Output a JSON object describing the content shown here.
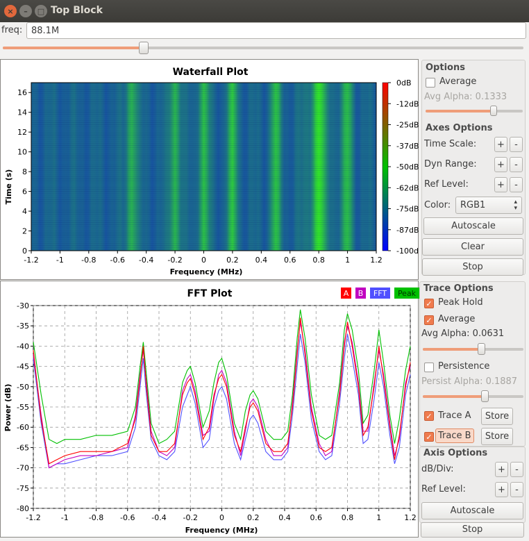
{
  "window": {
    "title": "Top Block"
  },
  "freq": {
    "label": "freq:",
    "value": "88.1M",
    "slider_fraction": 0.27
  },
  "waterfall": {
    "title": "Waterfall Plot",
    "xlabel": "Frequency (MHz)",
    "ylabel": "Time (s)",
    "x_ticks": [
      "-1.2",
      "-1",
      "-0.8",
      "-0.6",
      "-0.4",
      "-0.2",
      "0",
      "0.2",
      "0.4",
      "0.6",
      "0.8",
      "1",
      "1.2"
    ],
    "y_ticks": [
      "0",
      "2",
      "4",
      "6",
      "8",
      "10",
      "12",
      "14",
      "16"
    ],
    "colorbar_ticks": [
      "0dB",
      "-12dB",
      "-25dB",
      "-37dB",
      "-50dB",
      "-62dB",
      "-75dB",
      "-87dB",
      "-100dB"
    ]
  },
  "waterfall_options": {
    "options_title": "Options",
    "average_label": "Average",
    "average_checked": false,
    "avg_alpha_label": "Avg Alpha: 0.1333",
    "avg_alpha_fraction": 0.7,
    "axes_title": "Axes Options",
    "time_scale_label": "Time Scale:",
    "dyn_range_label": "Dyn Range:",
    "ref_level_label": "Ref Level:",
    "color_label": "Color:",
    "color_value": "RGB1",
    "plus": "+",
    "minus": "-",
    "autoscale": "Autoscale",
    "clear": "Clear",
    "stop": "Stop"
  },
  "fft": {
    "title": "FFT Plot",
    "xlabel": "Frequency (MHz)",
    "ylabel": "Power (dB)",
    "legend": [
      {
        "label": "A",
        "color": "#ff0000"
      },
      {
        "label": "B",
        "color": "#c000c0"
      },
      {
        "label": "FFT",
        "color": "#5050ff"
      },
      {
        "label": "Peak",
        "color": "#00c000"
      }
    ]
  },
  "fft_options": {
    "trace_title": "Trace Options",
    "peak_hold_label": "Peak Hold",
    "peak_hold_checked": true,
    "average_label": "Average",
    "average_checked": true,
    "avg_alpha_label": "Avg Alpha: 0.0631",
    "avg_alpha_fraction": 0.58,
    "persistence_label": "Persistence",
    "persistence_checked": false,
    "persist_alpha_label": "Persist Alpha: 0.1887",
    "persist_alpha_fraction": 0.62,
    "trace_a_label": "Trace A",
    "trace_a_checked": true,
    "trace_b_label": "Trace B",
    "trace_b_checked": true,
    "store": "Store",
    "axis_title": "Axis Options",
    "db_div_label": "dB/Div:",
    "ref_level_label": "Ref Level:",
    "plus": "+",
    "minus": "-",
    "autoscale": "Autoscale",
    "stop": "Stop"
  },
  "chart_data": [
    {
      "type": "heatmap",
      "title": "Waterfall Plot",
      "xlabel": "Frequency (MHz)",
      "ylabel": "Time (s)",
      "xlim": [
        -1.2,
        1.2
      ],
      "ylim": [
        0,
        17
      ],
      "colorbar_range_db": [
        -100,
        0
      ],
      "strong_signal_columns_mhz": [
        -0.5,
        -0.2,
        0.0,
        0.2,
        0.5,
        0.8,
        1.0
      ]
    },
    {
      "type": "line",
      "title": "FFT Plot",
      "xlabel": "Frequency (MHz)",
      "ylabel": "Power (dB)",
      "xlim": [
        -1.2,
        1.2
      ],
      "ylim": [
        -80,
        -30
      ],
      "x_ticks": [
        -1.2,
        -1,
        -0.8,
        -0.6,
        -0.4,
        -0.2,
        0,
        0.2,
        0.4,
        0.6,
        0.8,
        1,
        1.2
      ],
      "y_ticks": [
        -30,
        -35,
        -40,
        -45,
        -50,
        -55,
        -60,
        -65,
        -70,
        -75,
        -80
      ],
      "grid": true,
      "legend_position": "top-right",
      "x": [
        -1.2,
        -1.15,
        -1.1,
        -1.05,
        -1.0,
        -0.9,
        -0.8,
        -0.7,
        -0.6,
        -0.55,
        -0.52,
        -0.5,
        -0.48,
        -0.45,
        -0.4,
        -0.35,
        -0.3,
        -0.25,
        -0.22,
        -0.2,
        -0.17,
        -0.12,
        -0.08,
        -0.05,
        -0.02,
        0.0,
        0.03,
        0.08,
        0.12,
        0.15,
        0.18,
        0.2,
        0.23,
        0.28,
        0.33,
        0.38,
        0.42,
        0.45,
        0.48,
        0.5,
        0.53,
        0.57,
        0.62,
        0.66,
        0.7,
        0.75,
        0.78,
        0.8,
        0.83,
        0.87,
        0.9,
        0.93,
        0.97,
        1.0,
        1.03,
        1.07,
        1.1,
        1.13,
        1.17,
        1.2
      ],
      "series": [
        {
          "name": "A",
          "values": [
            -41,
            -58,
            -69,
            -68,
            -67,
            -66,
            -66,
            -66,
            -64,
            -58,
            -48,
            -40,
            -50,
            -62,
            -66,
            -66,
            -64,
            -52,
            -49,
            -48,
            -52,
            -63,
            -60,
            -52,
            -48,
            -47,
            -50,
            -62,
            -66,
            -60,
            -55,
            -54,
            -56,
            -64,
            -66,
            -66,
            -64,
            -55,
            -42,
            -33,
            -42,
            -56,
            -65,
            -66,
            -65,
            -52,
            -40,
            -34,
            -40,
            -50,
            -62,
            -60,
            -50,
            -40,
            -48,
            -60,
            -68,
            -62,
            -50,
            -44
          ]
        },
        {
          "name": "B",
          "values": [
            -42,
            -57,
            -70,
            -69,
            -68,
            -67,
            -67,
            -66,
            -65,
            -57,
            -47,
            -41,
            -49,
            -61,
            -66,
            -67,
            -65,
            -51,
            -48,
            -47,
            -51,
            -62,
            -61,
            -53,
            -47,
            -46,
            -49,
            -61,
            -67,
            -61,
            -54,
            -53,
            -55,
            -63,
            -67,
            -67,
            -65,
            -54,
            -41,
            -34,
            -41,
            -55,
            -64,
            -67,
            -66,
            -51,
            -39,
            -35,
            -39,
            -49,
            -61,
            -61,
            -49,
            -41,
            -47,
            -59,
            -67,
            -63,
            -49,
            -45
          ]
        },
        {
          "name": "FFT",
          "values": [
            -43,
            -59,
            -70,
            -69,
            -69,
            -68,
            -67,
            -67,
            -66,
            -60,
            -50,
            -43,
            -52,
            -63,
            -67,
            -68,
            -66,
            -55,
            -52,
            -50,
            -54,
            -65,
            -63,
            -55,
            -51,
            -50,
            -53,
            -64,
            -68,
            -63,
            -58,
            -57,
            -59,
            -66,
            -68,
            -68,
            -66,
            -57,
            -45,
            -37,
            -44,
            -58,
            -66,
            -68,
            -67,
            -54,
            -43,
            -37,
            -43,
            -52,
            -64,
            -63,
            -53,
            -44,
            -50,
            -62,
            -69,
            -65,
            -52,
            -47
          ]
        },
        {
          "name": "Peak",
          "values": [
            -39,
            -52,
            -63,
            -64,
            -63,
            -63,
            -62,
            -62,
            -61,
            -55,
            -45,
            -39,
            -47,
            -59,
            -64,
            -63,
            -61,
            -49,
            -46,
            -45,
            -49,
            -60,
            -56,
            -49,
            -44,
            -43,
            -47,
            -59,
            -63,
            -56,
            -52,
            -51,
            -53,
            -61,
            -63,
            -63,
            -61,
            -52,
            -38,
            -31,
            -38,
            -52,
            -62,
            -63,
            -62,
            -49,
            -36,
            -32,
            -36,
            -46,
            -59,
            -57,
            -46,
            -36,
            -44,
            -57,
            -64,
            -58,
            -46,
            -40
          ]
        }
      ]
    }
  ]
}
